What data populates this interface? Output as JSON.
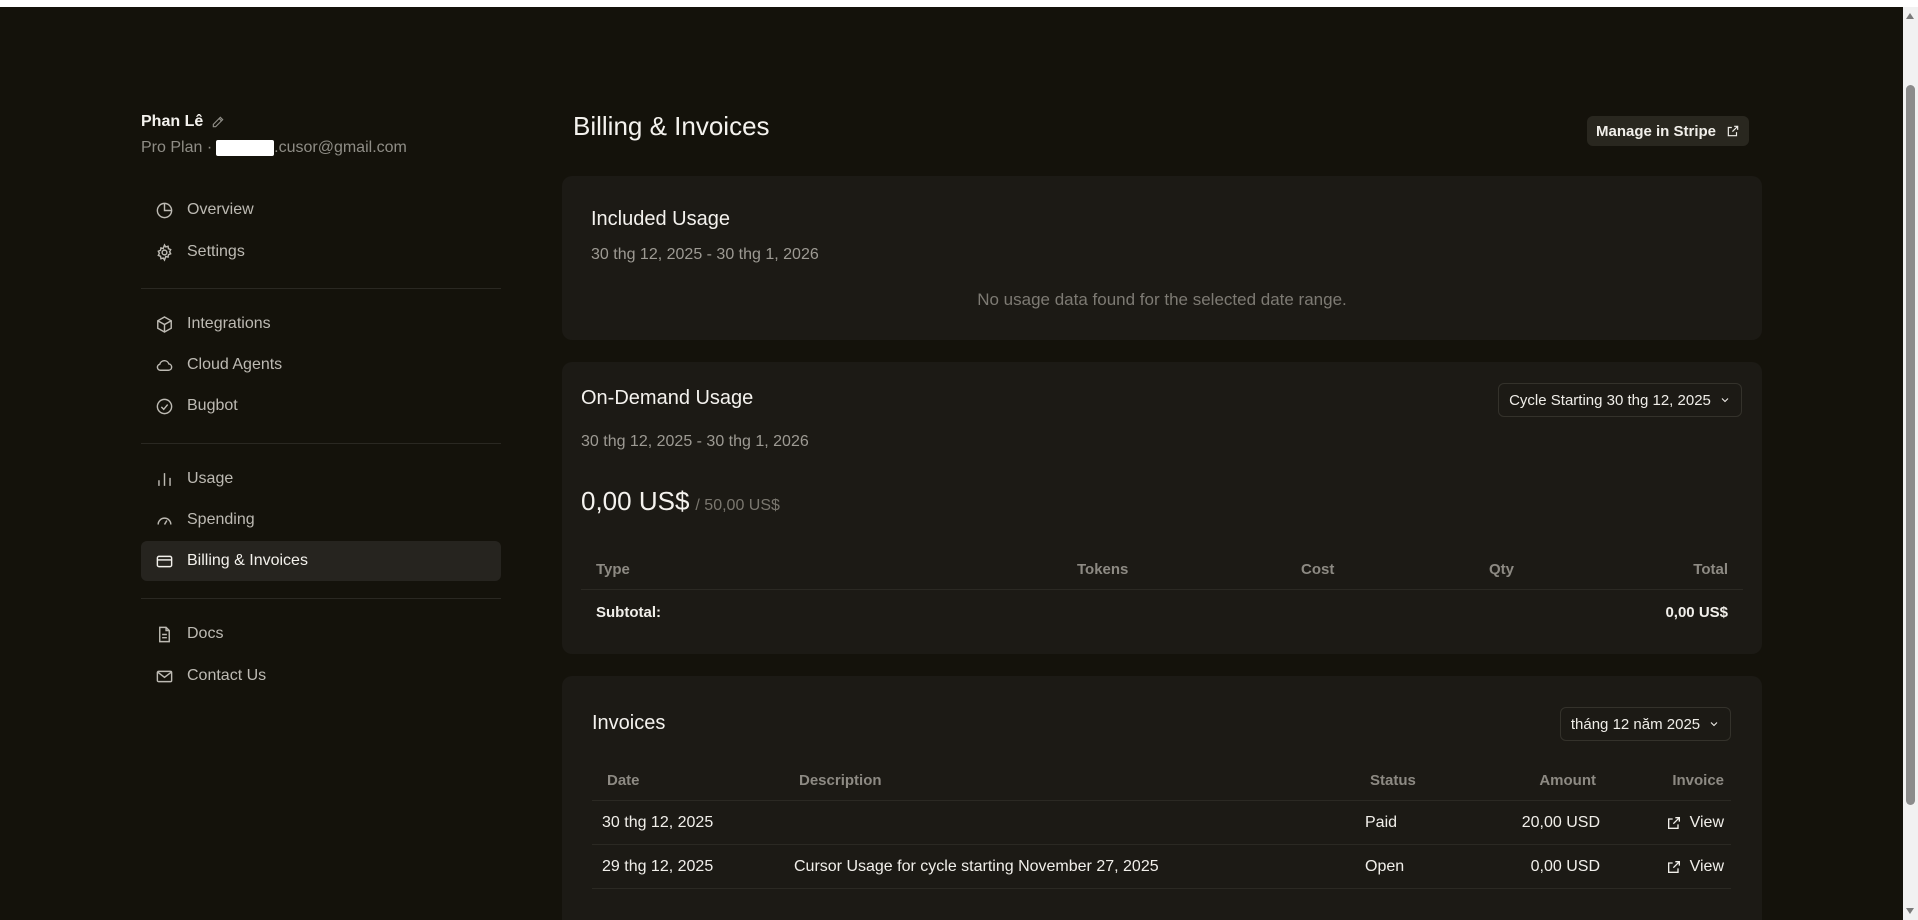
{
  "profile": {
    "name": "Phan Lê",
    "plan": "Pro Plan ·",
    "email_suffix": ".cusor@gmail.com"
  },
  "sidebar": {
    "items": [
      {
        "label": "Overview",
        "icon": "pie-chart-icon"
      },
      {
        "label": "Settings",
        "icon": "gear-icon"
      },
      {
        "label": "Integrations",
        "icon": "cube-icon"
      },
      {
        "label": "Cloud Agents",
        "icon": "cloud-icon"
      },
      {
        "label": "Bugbot",
        "icon": "check-circle-icon"
      },
      {
        "label": "Usage",
        "icon": "bar-chart-icon"
      },
      {
        "label": "Spending",
        "icon": "gauge-icon"
      },
      {
        "label": "Billing & Invoices",
        "icon": "credit-card-icon",
        "active": true
      },
      {
        "label": "Docs",
        "icon": "document-icon"
      },
      {
        "label": "Contact Us",
        "icon": "mail-icon"
      }
    ]
  },
  "header": {
    "title": "Billing & Invoices",
    "stripe_label": "Manage in Stripe"
  },
  "included_usage": {
    "title": "Included Usage",
    "range": "30 thg 12, 2025 - 30 thg 1, 2026",
    "empty": "No usage data found for the selected date range."
  },
  "on_demand": {
    "title": "On-Demand Usage",
    "cycle_select": "Cycle Starting 30 thg 12, 2025",
    "range": "30 thg 12, 2025 - 30 thg 1, 2026",
    "spent": "0,00 US$",
    "limit": "/ 50,00 US$",
    "columns": [
      "Type",
      "Tokens",
      "Cost",
      "Qty",
      "Total"
    ],
    "subtotal_label": "Subtotal:",
    "subtotal_value": "0,00 US$"
  },
  "invoices": {
    "title": "Invoices",
    "month_select": "tháng 12 năm 2025",
    "columns": [
      "Date",
      "Description",
      "Status",
      "Amount",
      "Invoice"
    ],
    "rows": [
      {
        "date": "30 thg 12, 2025",
        "description": "",
        "status": "Paid",
        "amount": "20,00 USD",
        "link": "View"
      },
      {
        "date": "29 thg 12, 2025",
        "description": "Cursor Usage for cycle starting November 27, 2025",
        "status": "Open",
        "amount": "0,00 USD",
        "link": "View"
      }
    ]
  },
  "colors": {
    "background": "#14120b",
    "card": "#1c1a15",
    "active_nav": "#26241f",
    "text": "#f4f2ee",
    "muted": "#8d8a83"
  }
}
